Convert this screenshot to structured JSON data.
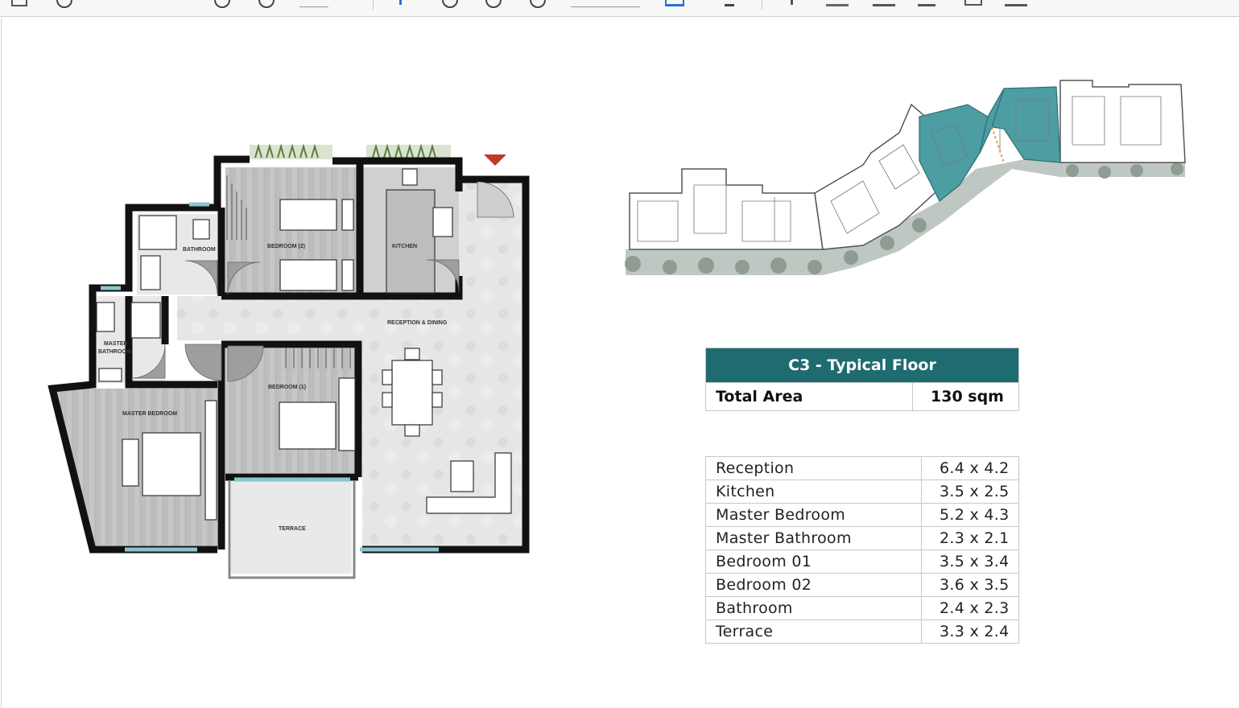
{
  "floor_title": "C3 - Typical Floor",
  "total_area": {
    "label": "Total Area",
    "value": "130 sqm"
  },
  "rooms": [
    {
      "name": "Reception",
      "size": "6.4 x 4.2"
    },
    {
      "name": "Kitchen",
      "size": "3.5 x 2.5"
    },
    {
      "name": "Master Bedroom",
      "size": "5.2 x 4.3"
    },
    {
      "name": "Master Bathroom",
      "size": "2.3 x 2.1"
    },
    {
      "name": "Bedroom 01",
      "size": "3.5 x 3.4"
    },
    {
      "name": "Bedroom 02",
      "size": "3.6 x 3.5"
    },
    {
      "name": "Bathroom",
      "size": "2.4 x 2.3"
    },
    {
      "name": "Terrace",
      "size": "3.3 x 2.4"
    }
  ],
  "plan_labels": {
    "bathroom": "BATHROOM",
    "bedroom2": "BEDROOM (2)",
    "kitchen": "KITCHEN",
    "reception": "RECEPTION & DINING",
    "master_bathroom_1": "MASTER",
    "master_bathroom_2": "BATHROOM",
    "bedroom1": "BEDROOM (1)",
    "master_bedroom": "MASTER BEDROOM",
    "terrace": "TERRACE"
  },
  "colors": {
    "accent": "#1e6b70",
    "highlight": "#4d9ea3",
    "wall": "#111111",
    "marker": "#c0392b"
  }
}
